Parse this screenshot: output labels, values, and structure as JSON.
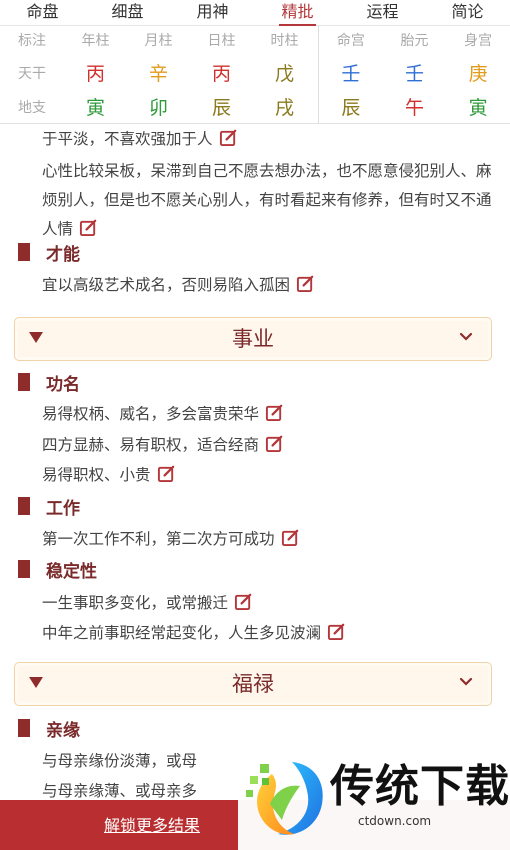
{
  "tabs": [
    "命盘",
    "细盘",
    "用神",
    "精批",
    "运程",
    "简论"
  ],
  "active_tab_index": 3,
  "pillars": {
    "left_header": [
      "标注",
      "年柱",
      "月柱",
      "日柱",
      "时柱"
    ],
    "tiangan_label": "天干",
    "dizhi_label": "地支",
    "tiangan": [
      "丙",
      "辛",
      "丙",
      "戊"
    ],
    "dizhi": [
      "寅",
      "卯",
      "辰",
      "戌"
    ],
    "right_header": [
      "命宫",
      "胎元",
      "身宫"
    ],
    "right_tiangan": [
      "壬",
      "壬",
      "庚"
    ],
    "right_dizhi": [
      "辰",
      "午",
      "寅"
    ]
  },
  "content": {
    "p1": "于平淡，不喜欢强加于人",
    "p2": "心性比较呆板，呆滞到自己不愿去想办法，也不愿意侵犯别人、麻烦别人，但是也不愿关心别人，有时看起来有修养，但有时又不通人情",
    "sec_talent": "才能",
    "p3": "宜以高级艺术成名，否则易陷入孤困",
    "cat_career": "事业",
    "sec_fame": "功名",
    "p4": "易得权柄、威名，多会富贵荣华",
    "p5": "四方显赫、易有职权，适合经商",
    "p6": "易得职权、小贵",
    "sec_work": "工作",
    "p7": "第一次工作不利，第二次方可成功",
    "sec_stability": "稳定性",
    "p8": "一生事职多变化，或常搬迁",
    "p9": "中年之前事职经常起变化，人生多见波澜",
    "cat_fortune": "福禄",
    "sec_kin": "亲缘",
    "p10": "与母亲缘份淡薄，或母",
    "p11": "与母亲缘薄、或母亲多"
  },
  "bottom": {
    "unlock": "解锁更多结果"
  },
  "watermark": {
    "brand": "传统下载",
    "url": "ctdown.com"
  },
  "colors": {
    "accent": "#b3363a",
    "brand_red": "#8e2b2b",
    "fire_red": "#d0312d",
    "metal_orange": "#e39b1c",
    "water_blue": "#2f6fd6",
    "wood_green": "#2e9a3a",
    "earth_olive": "#8a7a1c"
  }
}
